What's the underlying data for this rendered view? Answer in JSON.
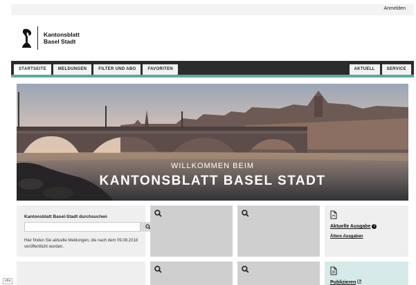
{
  "topbar": {
    "login_label": "Anmelden"
  },
  "logo": {
    "line1": "Kantonsblatt",
    "line2": "Basel Stadt"
  },
  "nav": {
    "left": [
      "STARTSEITE",
      "MELDUNGEN",
      "FILTER UND ABO",
      "FAVORITEN"
    ],
    "right": [
      "AKTUELL",
      "SERVICE"
    ],
    "accent_color": "#5fa9a1"
  },
  "hero": {
    "welcome": "WILLKOMMEN BEIM",
    "title": "KANTONSBLATT BASEL STADT"
  },
  "search": {
    "title": "Kantonsblatt Basel-Stadt durchsuchen",
    "placeholder": "",
    "note": "Hier finden Sie aktuelle Meldungen, die nach dem 09.08.2018 veröffentlicht wurden."
  },
  "tiles": {
    "current_issue_label": "Aktuelle Ausgabe",
    "older_issues_label": "Ältere Ausgaben",
    "publish_label": "Publizieren"
  },
  "cookie_tag": "etta"
}
